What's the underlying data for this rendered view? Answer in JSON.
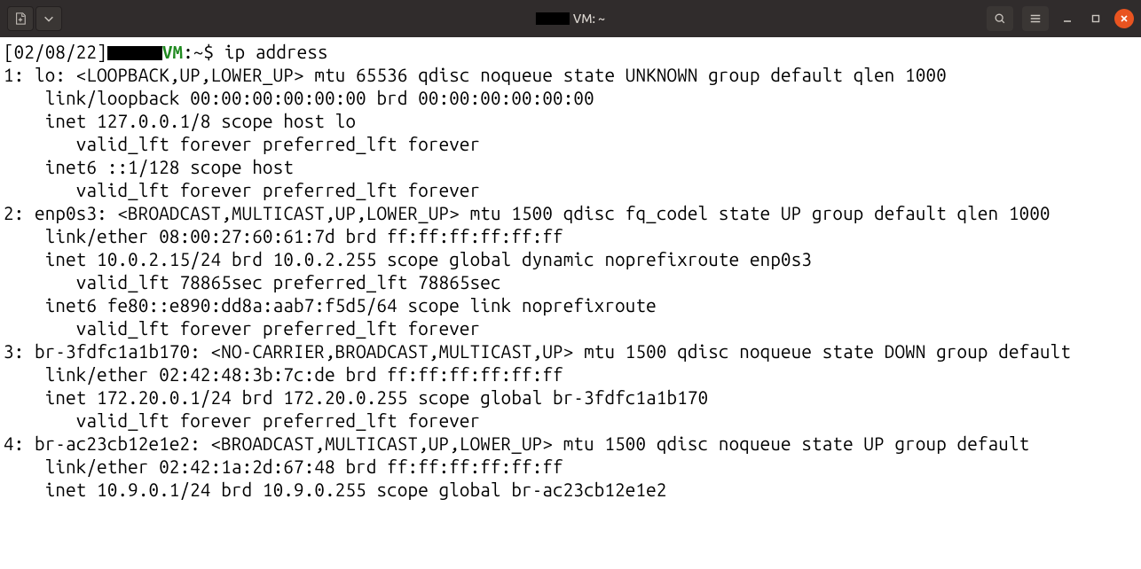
{
  "titlebar": {
    "title_suffix": "VM: ~"
  },
  "prompt": {
    "date": "[02/08/22]",
    "hostvm": "VM",
    "path_and_sep": ":~$ ",
    "command": "ip address"
  },
  "output": {
    "l1": "1: lo: <LOOPBACK,UP,LOWER_UP> mtu 65536 qdisc noqueue state UNKNOWN group default qlen 1000",
    "l2": "    link/loopback 00:00:00:00:00:00 brd 00:00:00:00:00:00",
    "l3": "    inet 127.0.0.1/8 scope host lo",
    "l4": "       valid_lft forever preferred_lft forever",
    "l5": "    inet6 ::1/128 scope host ",
    "l6": "       valid_lft forever preferred_lft forever",
    "l7": "2: enp0s3: <BROADCAST,MULTICAST,UP,LOWER_UP> mtu 1500 qdisc fq_codel state UP group default qlen 1000",
    "l8": "    link/ether 08:00:27:60:61:7d brd ff:ff:ff:ff:ff:ff",
    "l9": "    inet 10.0.2.15/24 brd 10.0.2.255 scope global dynamic noprefixroute enp0s3",
    "l10": "       valid_lft 78865sec preferred_lft 78865sec",
    "l11": "    inet6 fe80::e890:dd8a:aab7:f5d5/64 scope link noprefixroute ",
    "l12": "       valid_lft forever preferred_lft forever",
    "l13": "3: br-3fdfc1a1b170: <NO-CARRIER,BROADCAST,MULTICAST,UP> mtu 1500 qdisc noqueue state DOWN group default ",
    "l14": "    link/ether 02:42:48:3b:7c:de brd ff:ff:ff:ff:ff:ff",
    "l15": "    inet 172.20.0.1/24 brd 172.20.0.255 scope global br-3fdfc1a1b170",
    "l16": "       valid_lft forever preferred_lft forever",
    "l17": "4: br-ac23cb12e1e2: <BROADCAST,MULTICAST,UP,LOWER_UP> mtu 1500 qdisc noqueue state UP group default ",
    "l18": "    link/ether 02:42:1a:2d:67:48 brd ff:ff:ff:ff:ff:ff",
    "l19": "    inet 10.9.0.1/24 brd 10.9.0.255 scope global br-ac23cb12e1e2"
  }
}
